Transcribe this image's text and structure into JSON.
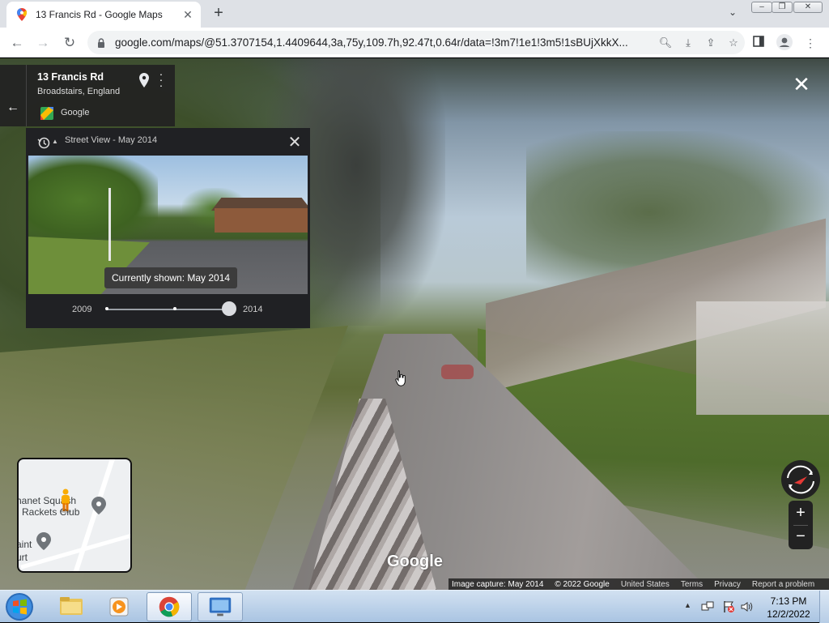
{
  "browser": {
    "tab_title": "13 Francis Rd - Google Maps",
    "url": "google.com/maps/@51.3707154,1.4409644,3a,75y,109.7h,92.47t,0.64r/data=!3m7!1e1!3m5!1sBUjXkkX..."
  },
  "address_card": {
    "title": "13 Francis Rd",
    "subtitle": "Broadstairs, England",
    "provider": "Google"
  },
  "time_machine": {
    "title": "Street View - May 2014",
    "tooltip": "Currently shown: May 2014",
    "start_year": "2009",
    "end_year": "2014",
    "position": 1.0
  },
  "minimap": {
    "label_line1": "hanet Squash",
    "label_line2": "Rackets Club",
    "label_line3": "aint",
    "label_line4": "urt"
  },
  "watermark": "Google",
  "footer": {
    "capture": "Image capture: May 2014",
    "copyright": "© 2022 Google",
    "country": "United States",
    "terms": "Terms",
    "privacy": "Privacy",
    "report": "Report a problem"
  },
  "zoom": {
    "in": "+",
    "out": "−"
  },
  "taskbar": {
    "time": "7:13 PM",
    "date": "12/2/2022"
  },
  "colors": {
    "chrome_tab_bg": "#dee1e6",
    "panel_bg": "#202124",
    "taskbar_top": "#d2e1f1",
    "taskbar_bottom": "#a9c4e2"
  },
  "icons": [
    "maps-favicon",
    "lock-icon",
    "search-icon",
    "install-icon",
    "share-icon",
    "star-icon",
    "side-panel-icon",
    "profile-icon",
    "kebab-menu-icon",
    "back-arrow-icon",
    "location-pin-icon",
    "history-clock-icon",
    "close-icon",
    "pegman-icon",
    "compass-icon",
    "windows-start-icon",
    "chrome-icon"
  ]
}
